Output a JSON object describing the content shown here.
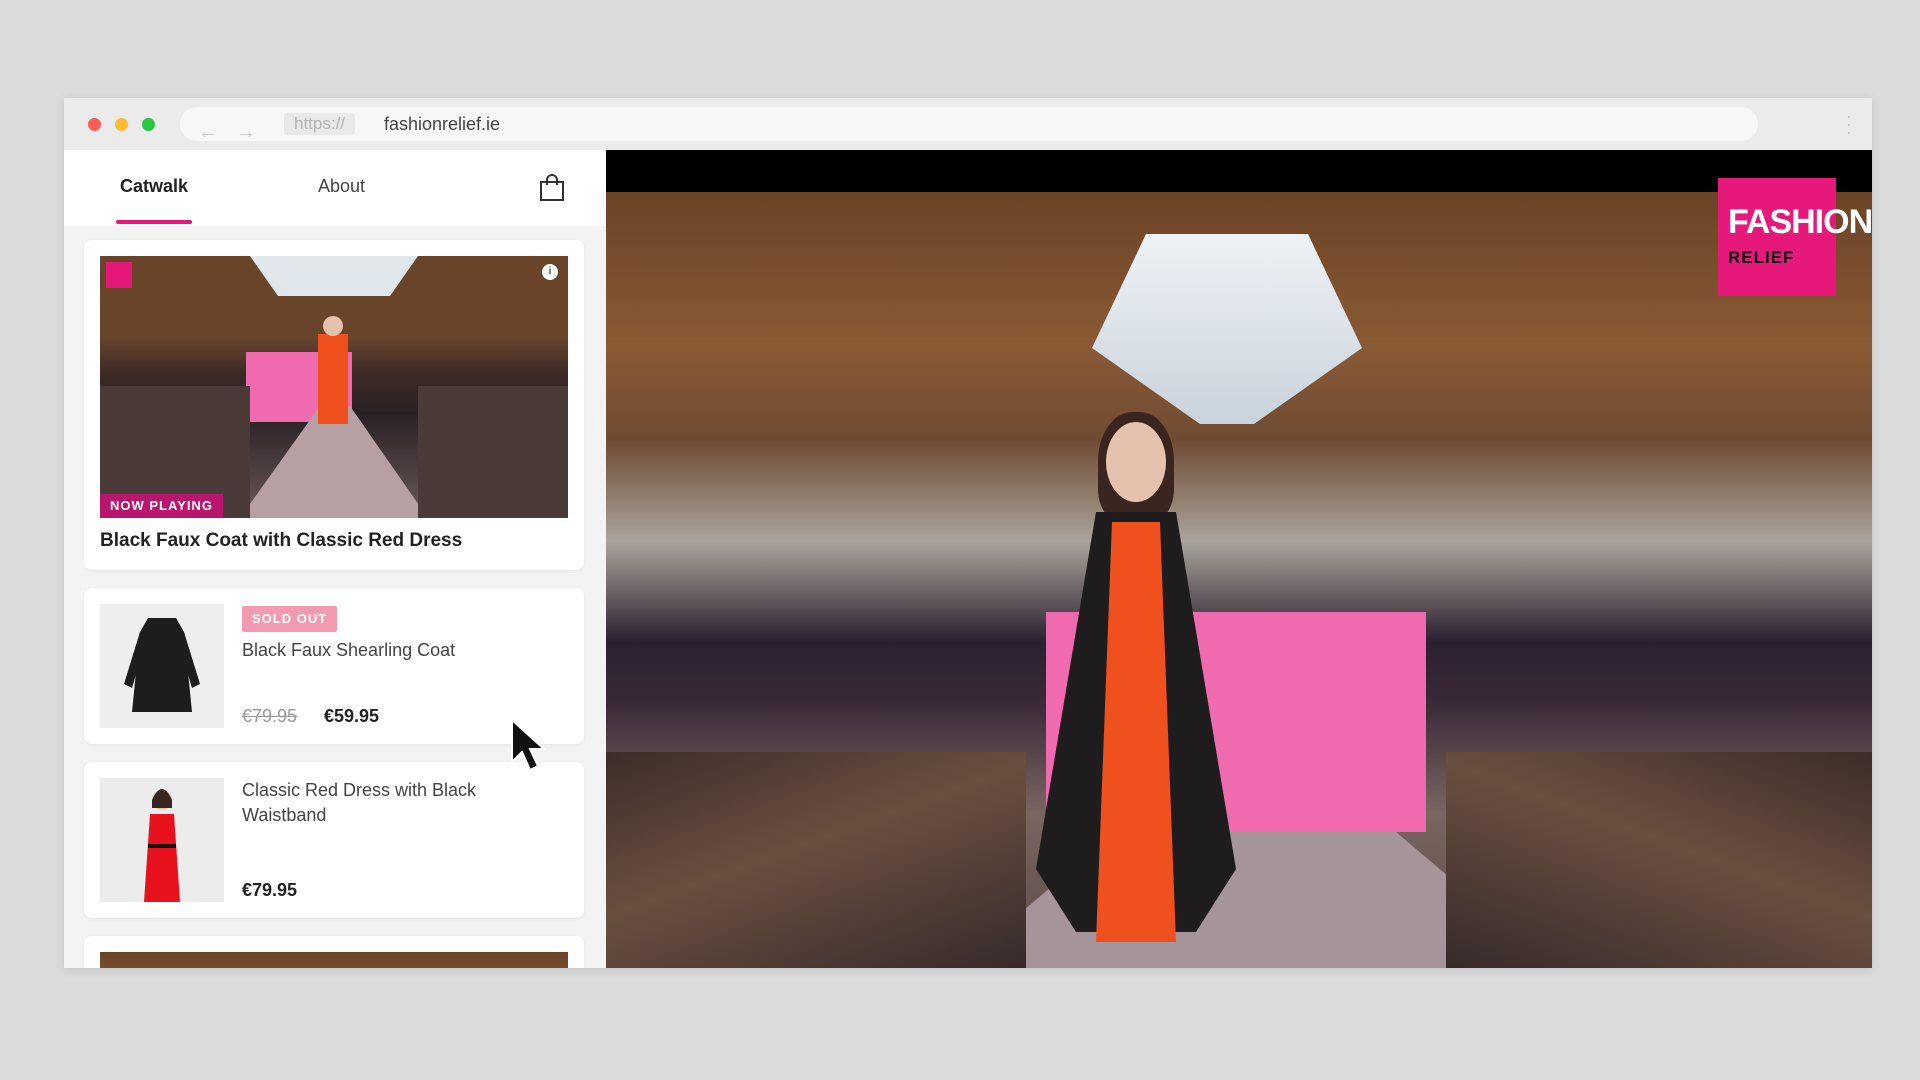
{
  "browser": {
    "url_scheme": "https://",
    "url_host": "fashionrelief.ie",
    "back_icon": "arrow-left",
    "forward_icon": "arrow-right",
    "menu_icon": "vertical-dots"
  },
  "tabs": [
    {
      "label": "Catwalk",
      "active": true
    },
    {
      "label": "About",
      "active": false
    }
  ],
  "cart_icon": "shopping-bag",
  "now_playing_card": {
    "badge": "NOW PLAYING",
    "title": "Black Faux Coat with Classic Red Dress"
  },
  "products": [
    {
      "status": "SOLD OUT",
      "title": "Black Faux Shearling Coat",
      "old_price": "€79.95",
      "price": "€59.95"
    },
    {
      "title": "Classic Red Dress with Black Waistband",
      "price": "€79.95"
    }
  ],
  "video": {
    "logo_line1": "FASHION",
    "logo_line2": "RELIEF"
  },
  "colors": {
    "accent": "#e6197a",
    "now_playing": "#b8156c",
    "sold_out": "#f29ab0"
  }
}
